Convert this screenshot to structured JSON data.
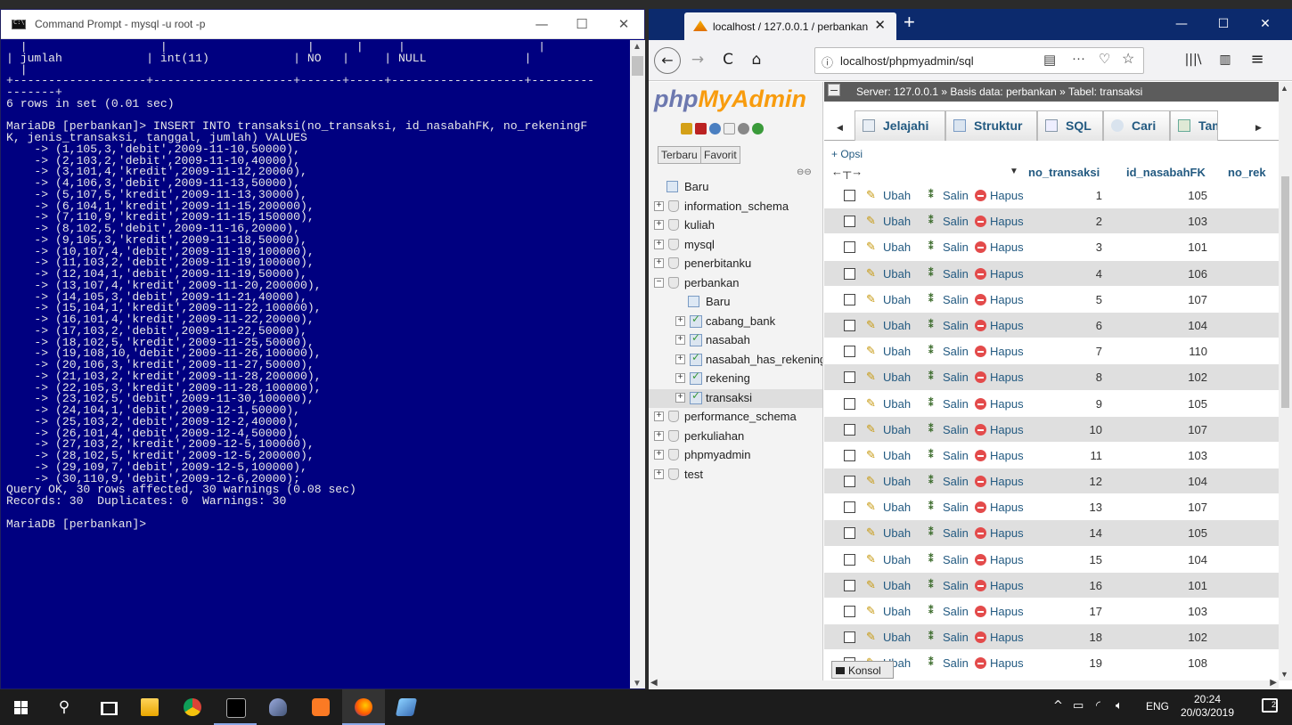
{
  "cmd": {
    "title": "Command Prompt - mysql  -u root -p",
    "controls": {
      "minimize": "—",
      "maximize": "☐",
      "close": "✕"
    },
    "lines": [
      "  |                   |                    |      |     |                   |",
      "| jumlah            | int(11)            | NO   |     | NULL              |",
      "  |",
      "+-------------------+--------------------+------+-----+-------------------+---------",
      "-------+",
      "6 rows in set (0.01 sec)",
      "",
      "MariaDB [perbankan]> INSERT INTO transaksi(no_transaksi, id_nasabahFK, no_rekeningF",
      "K, jenis_transaksi, tanggal, jumlah) VALUES",
      "    -> (1,105,3,'debit',2009-11-10,50000),",
      "    -> (2,103,2,'debit',2009-11-10,40000),",
      "    -> (3,101,4,'kredit',2009-11-12,20000),",
      "    -> (4,106,3,'debit',2009-11-13,50000),",
      "    -> (5,107,5,'kredit',2009-11-13,30000),",
      "    -> (6,104,1,'kredit',2009-11-15,200000),",
      "    -> (7,110,9,'kredit',2009-11-15,150000),",
      "    -> (8,102,5,'debit',2009-11-16,20000),",
      "    -> (9,105,3,'kredit',2009-11-18,50000),",
      "    -> (10,107,4,'debit',2009-11-19,100000),",
      "    -> (11,103,2,'debit',2009-11-19,100000),",
      "    -> (12,104,1,'debit',2009-11-19,50000),",
      "    -> (13,107,4,'kredit',2009-11-20,200000),",
      "    -> (14,105,3,'debit',2009-11-21,40000),",
      "    -> (15,104,1,'kredit',2009-11-22,100000),",
      "    -> (16,101,4,'kredit',2009-11-22,20000),",
      "    -> (17,103,2,'debit',2009-11-22,50000),",
      "    -> (18,102,5,'kredit',2009-11-25,50000),",
      "    -> (19,108,10,'debit',2009-11-26,100000),",
      "    -> (20,106,3,'kredit',2009-11-27,50000),",
      "    -> (21,103,2,'kredit',2009-11-28,200000),",
      "    -> (22,105,3,'kredit',2009-11-28,100000),",
      "    -> (23,102,5,'debit',2009-11-30,100000),",
      "    -> (24,104,1,'debit',2009-12-1,50000),",
      "    -> (25,103,2,'debit',2009-12-2,40000),",
      "    -> (26,101,4,'debit',2009-12-4,50000),",
      "    -> (27,103,2,'kredit',2009-12-5,100000),",
      "    -> (28,102,5,'kredit',2009-12-5,200000),",
      "    -> (29,109,7,'debit',2009-12-5,100000),",
      "    -> (30,110,9,'debit',2009-12-6,20000);",
      "Query OK, 30 rows affected, 30 warnings (0.08 sec)",
      "Records: 30  Duplicates: 0  Warnings: 30",
      "",
      "MariaDB [perbankan]>"
    ]
  },
  "firefox": {
    "tab_title": "localhost / 127.0.0.1 / perbankan",
    "tab_close": "✕",
    "new_tab": "+",
    "controls": {
      "minimize": "—",
      "maximize": "☐",
      "close": "✕"
    },
    "nav": {
      "back": "←",
      "forward": "→",
      "reload": "C",
      "home": "⌂",
      "library": "|||\\",
      "sidebar": "▥",
      "menu": "≡"
    },
    "url": "localhost/phpmyadmin/sql",
    "url_icons": {
      "info": "ⓘ",
      "reader": "▤",
      "more": "···",
      "pocket": "♡",
      "star": "☆"
    }
  },
  "pma": {
    "logo_php": "php",
    "logo_my": "MyAdmin",
    "tab_recent": "Terbaru",
    "tab_fav": "Favorit",
    "tree": [
      {
        "label": "Baru",
        "level": 0,
        "kind": "new"
      },
      {
        "label": "information_schema",
        "level": 0,
        "kind": "db"
      },
      {
        "label": "kuliah",
        "level": 0,
        "kind": "db"
      },
      {
        "label": "mysql",
        "level": 0,
        "kind": "db"
      },
      {
        "label": "penerbitanku",
        "level": 0,
        "kind": "db"
      },
      {
        "label": "perbankan",
        "level": 0,
        "kind": "db-open"
      },
      {
        "label": "Baru",
        "level": 1,
        "kind": "new"
      },
      {
        "label": "cabang_bank",
        "level": 1,
        "kind": "table"
      },
      {
        "label": "nasabah",
        "level": 1,
        "kind": "table"
      },
      {
        "label": "nasabah_has_rekening",
        "level": 1,
        "kind": "table"
      },
      {
        "label": "rekening",
        "level": 1,
        "kind": "table"
      },
      {
        "label": "transaksi",
        "level": 1,
        "kind": "table",
        "selected": true
      },
      {
        "label": "performance_schema",
        "level": 0,
        "kind": "db"
      },
      {
        "label": "perkuliahan",
        "level": 0,
        "kind": "db"
      },
      {
        "label": "phpmyadmin",
        "level": 0,
        "kind": "db"
      },
      {
        "label": "test",
        "level": 0,
        "kind": "db"
      }
    ],
    "breadcrumb": "Server: 127.0.0.1 » Basis data: perbankan » Tabel: transaksi",
    "tabs": {
      "jelajahi": "Jelajahi",
      "struktur": "Struktur",
      "sql": "SQL",
      "cari": "Cari",
      "tambah": "Tambahkan"
    },
    "opsi": "+ Opsi",
    "columns": {
      "no_transaksi": "no_transaksi",
      "id_nasabahFK": "id_nasabahFK",
      "no_rek": "no_rek"
    },
    "actions": {
      "edit": "Ubah",
      "copy": "Salin",
      "delete": "Hapus"
    },
    "rows": [
      {
        "no": "1",
        "id": "105"
      },
      {
        "no": "2",
        "id": "103"
      },
      {
        "no": "3",
        "id": "101"
      },
      {
        "no": "4",
        "id": "106"
      },
      {
        "no": "5",
        "id": "107"
      },
      {
        "no": "6",
        "id": "104"
      },
      {
        "no": "7",
        "id": "110"
      },
      {
        "no": "8",
        "id": "102"
      },
      {
        "no": "9",
        "id": "105"
      },
      {
        "no": "10",
        "id": "107"
      },
      {
        "no": "11",
        "id": "103"
      },
      {
        "no": "12",
        "id": "104"
      },
      {
        "no": "13",
        "id": "107"
      },
      {
        "no": "14",
        "id": "105"
      },
      {
        "no": "15",
        "id": "104"
      },
      {
        "no": "16",
        "id": "101"
      },
      {
        "no": "17",
        "id": "103"
      },
      {
        "no": "18",
        "id": "102"
      },
      {
        "no": "19",
        "id": "108"
      }
    ],
    "console": "Konsol"
  },
  "taskbar": {
    "search_icon": "⚲",
    "tray_icons": {
      "chevron": "^",
      "network": "▭",
      "wifi": "◜",
      "volume": "🔈︎"
    },
    "language": "ENG",
    "time": "20:24",
    "date": "20/03/2019",
    "notifications": "2"
  }
}
